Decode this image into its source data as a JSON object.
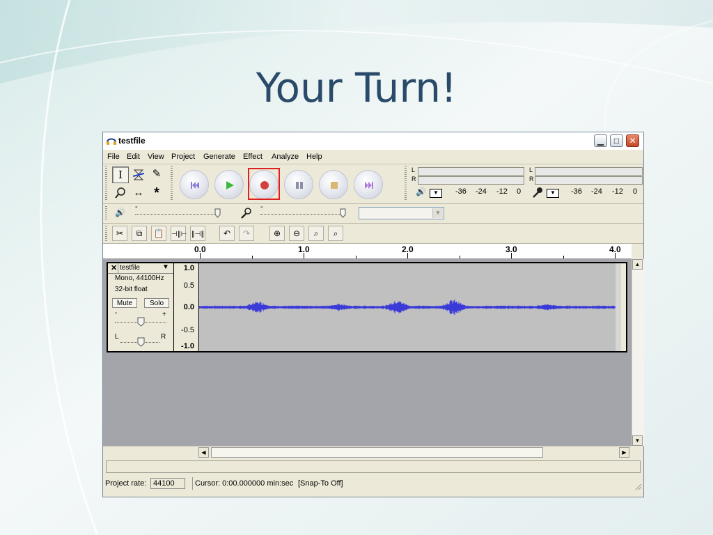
{
  "slide": {
    "title": "Your Turn!"
  },
  "window": {
    "title": "testfile",
    "minimize_icon": "minimize-icon",
    "maximize_icon": "maximize-icon",
    "close_icon": "close-icon"
  },
  "menu": [
    "File",
    "Edit",
    "View",
    "Project",
    "Generate",
    "Effect",
    "Analyze",
    "Help"
  ],
  "tools": {
    "selection": "selection-tool-icon",
    "envelope": "envelope-tool-icon",
    "draw": "draw-tool-icon",
    "zoom": "zoom-tool-icon",
    "timeshift": "timeshift-tool-icon",
    "multi": "multi-tool-icon"
  },
  "transport": [
    {
      "name": "skip-to-start-button",
      "icon": "skip-start-icon"
    },
    {
      "name": "play-button",
      "icon": "play-icon"
    },
    {
      "name": "record-button",
      "icon": "record-icon"
    },
    {
      "name": "pause-button",
      "icon": "pause-icon"
    },
    {
      "name": "stop-button",
      "icon": "stop-icon"
    },
    {
      "name": "skip-to-end-button",
      "icon": "skip-end-icon"
    }
  ],
  "meters": {
    "left_label": "L",
    "right_label": "R",
    "scale": [
      "-36",
      "-24",
      "-12",
      "0"
    ]
  },
  "mixer": {
    "output_minus": "-",
    "input_minus": "-"
  },
  "ruler": {
    "labels": [
      "0.0",
      "1.0",
      "2.0",
      "3.0",
      "4.0"
    ]
  },
  "track": {
    "close": "✕",
    "name": "testfile",
    "info_rate": "Mono, 44100Hz",
    "info_format": "32-bit float",
    "mute_label": "Mute",
    "solo_label": "Solo",
    "gain_minus": "-",
    "gain_plus": "+",
    "pan_left": "L",
    "pan_right": "R",
    "scale": [
      "1.0",
      "0.5",
      "0.0",
      "-0.5",
      "-1.0"
    ]
  },
  "status": {
    "rate_label": "Project rate:",
    "rate_value": "44100",
    "cursor_text": "Cursor: 0:00.000000 min:sec",
    "snap_text": "[Snap-To Off]"
  },
  "colors": {
    "waveform": "#3a3ad8",
    "record_highlight": "#e02020",
    "play_green": "#3cb83c",
    "record_red": "#d44040"
  }
}
